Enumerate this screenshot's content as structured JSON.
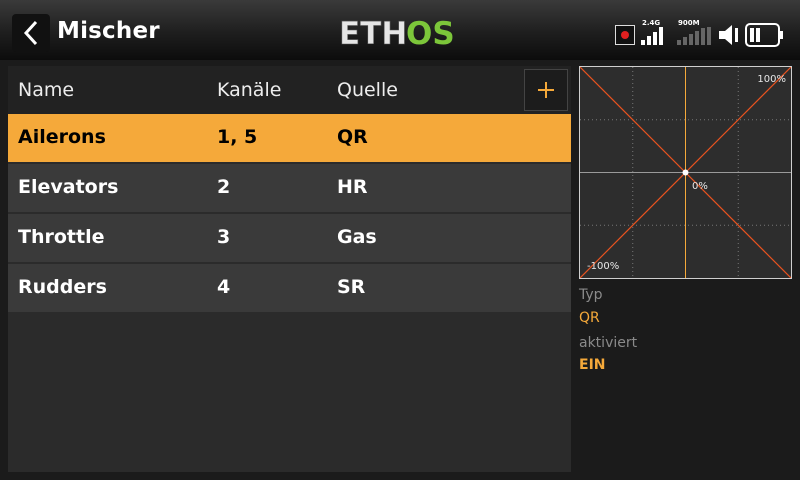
{
  "header": {
    "title": "Mischer",
    "logo_eth": "ETH",
    "logo_os": "OS",
    "signal_label_1": "2.4G",
    "signal_label_2": "900M"
  },
  "colors": {
    "accent": "#f5a93a",
    "logo_green": "#7cc63a",
    "curve_red": "#e8531f",
    "record_red": "#e02020"
  },
  "table": {
    "columns": [
      "Name",
      "Kanäle",
      "Quelle"
    ],
    "add_label": "+",
    "rows": [
      {
        "name": "Ailerons",
        "channels": "1, 5",
        "source": "QR"
      },
      {
        "name": "Elevators",
        "channels": "2",
        "source": "HR"
      },
      {
        "name": "Throttle",
        "channels": "3",
        "source": "Gas"
      },
      {
        "name": "Rudders",
        "channels": "4",
        "source": "SR"
      }
    ],
    "selected_index": 0
  },
  "curve": {
    "max_label": "100%",
    "mid_label": "0%",
    "min_label": "-100%"
  },
  "details": {
    "type_label": "Typ",
    "type_value": "QR",
    "active_label": "aktiviert",
    "active_value": "EIN"
  }
}
